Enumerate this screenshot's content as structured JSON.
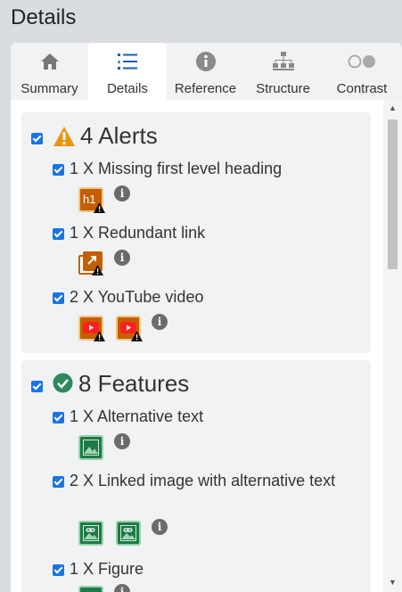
{
  "page": {
    "title": "Details"
  },
  "tabs": [
    {
      "label": "Summary",
      "icon": "home-icon"
    },
    {
      "label": "Details",
      "icon": "list-icon"
    },
    {
      "label": "Reference",
      "icon": "info-icon"
    },
    {
      "label": "Structure",
      "icon": "structure-icon"
    },
    {
      "label": "Contrast",
      "icon": "contrast-icon"
    }
  ],
  "alerts": {
    "heading": "4 Alerts",
    "items": [
      {
        "label": "1 X Missing first level heading",
        "icons": [
          "heading-h1-alert-icon"
        ],
        "badge_text": "h1"
      },
      {
        "label": "1 X Redundant link",
        "icons": [
          "redundant-link-alert-icon"
        ]
      },
      {
        "label": "2 X YouTube video",
        "icons": [
          "youtube-alert-icon",
          "youtube-alert-icon"
        ]
      }
    ]
  },
  "features": {
    "heading": "8 Features",
    "items": [
      {
        "label": "1 X Alternative text",
        "icons": [
          "image-alt-icon"
        ]
      },
      {
        "label": "2 X Linked image with alternative text",
        "icons": [
          "linked-image-icon",
          "linked-image-icon"
        ]
      },
      {
        "label": "1 X Figure",
        "icons": [
          "figure-icon"
        ]
      }
    ]
  },
  "colors": {
    "accent_checkbox": "#1a73e8",
    "alert": "#c35f00",
    "feature": "#1e7a46",
    "alert_heading_icon": "#e8950c",
    "feature_heading_icon": "#2f8a5b"
  }
}
